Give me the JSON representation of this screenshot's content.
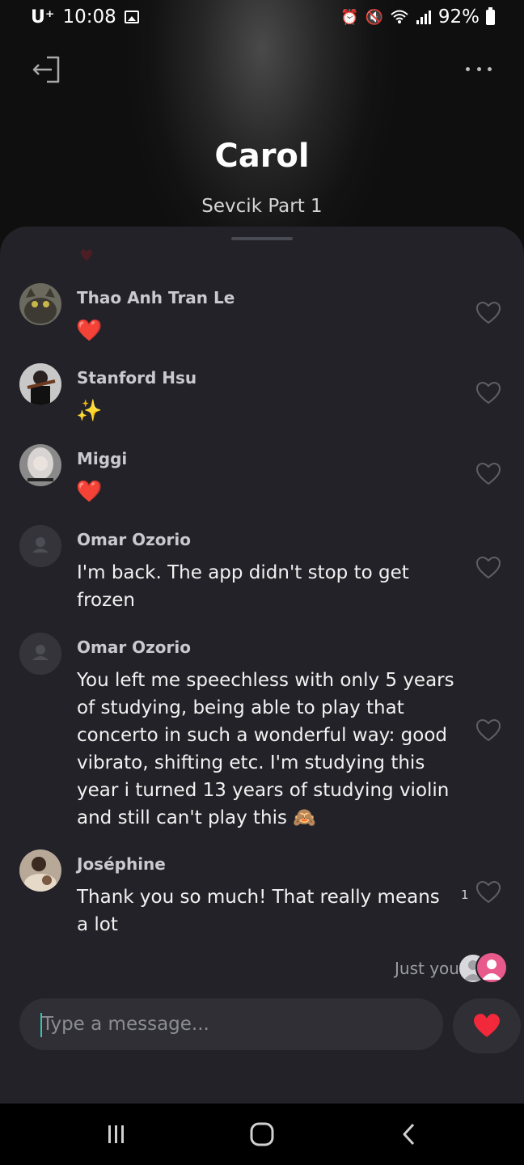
{
  "status_bar": {
    "carrier": "U⁺",
    "time": "10:08",
    "battery": "92%"
  },
  "header": {
    "title": "Carol",
    "subtitle": "Sevcik Part 1",
    "exit_icon": "exit-icon",
    "more_icon": "more-icon"
  },
  "messages": [
    {
      "name": "Thao Anh Tran Le",
      "emoji": "❤️",
      "avatar": "cat-photo"
    },
    {
      "name": "Stanford Hsu",
      "emoji": "✨",
      "avatar": "violinist-photo"
    },
    {
      "name": "Miggi",
      "emoji": "❤️",
      "avatar": "portrait-photo"
    },
    {
      "name": "Omar Ozorio",
      "text": "I'm back. The app didn't stop to get frozen",
      "avatar": "default-user"
    },
    {
      "name": "Omar Ozorio",
      "text": "You left me speechless with only 5 years of studying, being able to play that concerto in such a wonderful way: good vibrato, shifting etc. I'm studying this year i turned 13 years of studying violin and still can't play this 🙈",
      "avatar": "default-user"
    },
    {
      "name": "Joséphine",
      "text": "Thank you so much! That really means a lot",
      "avatar": "portrait-photo",
      "likes": "1"
    }
  ],
  "seen_by": {
    "label": "Just you"
  },
  "composer": {
    "placeholder": "Type a message...",
    "send_icon": "heart-icon"
  },
  "colors": {
    "accent_heart": "#f2293b",
    "sheet_bg": "#222228",
    "caret": "#35c4b5"
  }
}
